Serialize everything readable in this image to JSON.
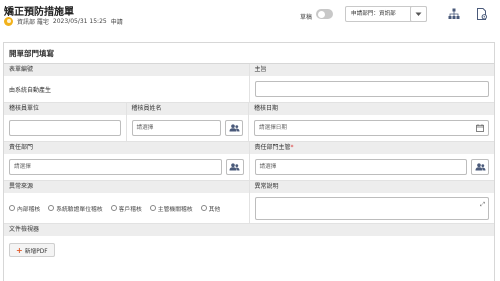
{
  "header": {
    "title": "矯正預防措施單",
    "author": "資訊部 羅宅",
    "date": "2023/05/31 15:25",
    "status": "申請",
    "draft_label": "草稿",
    "dept_select": "申請部門：資訊部"
  },
  "form": {
    "title": "開單部門填寫",
    "fields": {
      "form_no_label": "表單編號",
      "form_no_value": "由系統自動產生",
      "subject_label": "主旨",
      "checker_unit_label": "稽核員單位",
      "checker_name_label": "稽核員姓名",
      "checker_name_placeholder": "請選擇",
      "audit_date_label": "稽核日期",
      "audit_date_placeholder": "請選擇日期",
      "resp_dept_label": "責任部門",
      "resp_dept_placeholder": "請選擇",
      "resp_manager_label": "責任部門主管",
      "resp_manager_required": "*",
      "resp_manager_placeholder": "請選擇",
      "source_label": "異常來源",
      "source_options": [
        "內部稽核",
        "系統驗證單位稽核",
        "客戶稽核",
        "主管機關稽核",
        "其他"
      ],
      "description_label": "異常說明",
      "files_label": "文件檢視器",
      "add_pdf_label": "新增PDF"
    }
  }
}
